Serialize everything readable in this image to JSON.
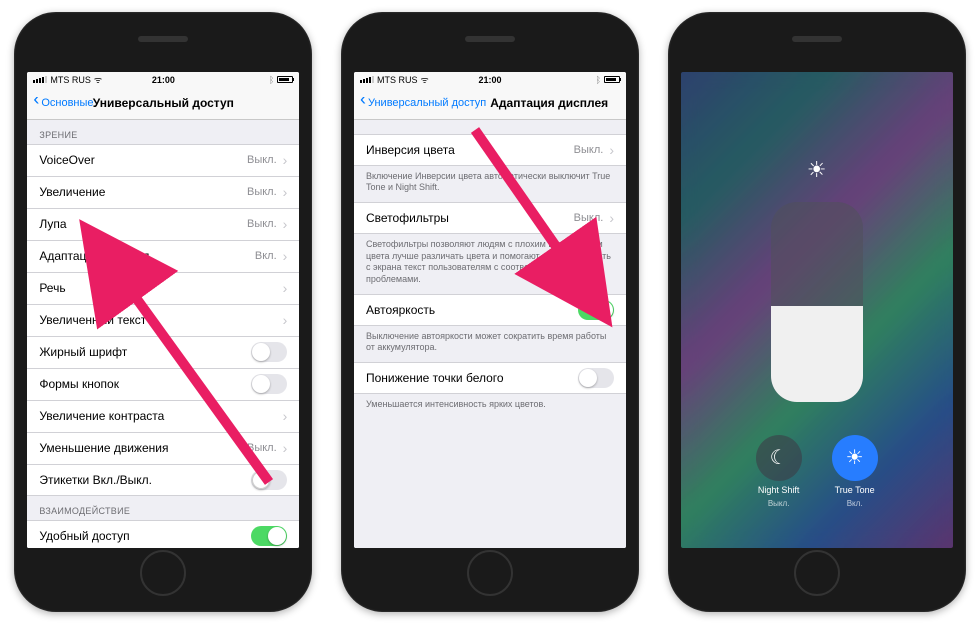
{
  "status": {
    "carrier": "MTS RUS",
    "time": "21:00",
    "wifi": "ᯤ",
    "bt": "ᛒ"
  },
  "s1": {
    "back": "Основные",
    "title": "Универсальный доступ",
    "hdr1": "ЗРЕНИЕ",
    "rows": [
      {
        "label": "VoiceOver",
        "value": "Выкл."
      },
      {
        "label": "Увеличение",
        "value": "Выкл."
      },
      {
        "label": "Лупа",
        "value": "Выкл."
      },
      {
        "label": "Адаптация дисплея",
        "value": "Вкл."
      },
      {
        "label": "Речь",
        "value": ""
      },
      {
        "label": "Увеличенный текст",
        "value": ""
      },
      {
        "label": "Жирный шрифт",
        "toggle": false
      },
      {
        "label": "Формы кнопок",
        "toggle": false
      },
      {
        "label": "Увеличение контраста",
        "value": ""
      },
      {
        "label": "Уменьшение движения",
        "value": "Выкл."
      },
      {
        "label": "Этикетки Вкл./Выкл.",
        "toggle": false,
        "indicator": true
      }
    ],
    "hdr2": "ВЗАИМОДЕЙСТВИЕ",
    "row2": {
      "label": "Удобный доступ",
      "toggle": true
    }
  },
  "s2": {
    "back": "Универсальный доступ",
    "title": "Адаптация дисплея",
    "r1": {
      "label": "Инверсия цвета",
      "value": "Выкл."
    },
    "note1": "Включение Инверсии цвета автоматически выключит True Tone и Night Shift.",
    "r2": {
      "label": "Светофильтры",
      "value": "Выкл."
    },
    "note2": "Светофильтры позволяют людям с плохим восприятием цвета лучше различать цвета и помогают легче считывать с экрана текст пользователям с соответствующими проблемами.",
    "r3": {
      "label": "Автояркость",
      "toggle": true
    },
    "note3": "Выключение автояркости может сократить время работы от аккумулятора.",
    "r4": {
      "label": "Понижение точки белого",
      "toggle": false
    },
    "note4": "Уменьшается интенсивность ярких цветов."
  },
  "cc": {
    "nightshift": {
      "title": "Night Shift",
      "sub": "Выкл."
    },
    "truetone": {
      "title": "True Tone",
      "sub": "Вкл."
    }
  }
}
